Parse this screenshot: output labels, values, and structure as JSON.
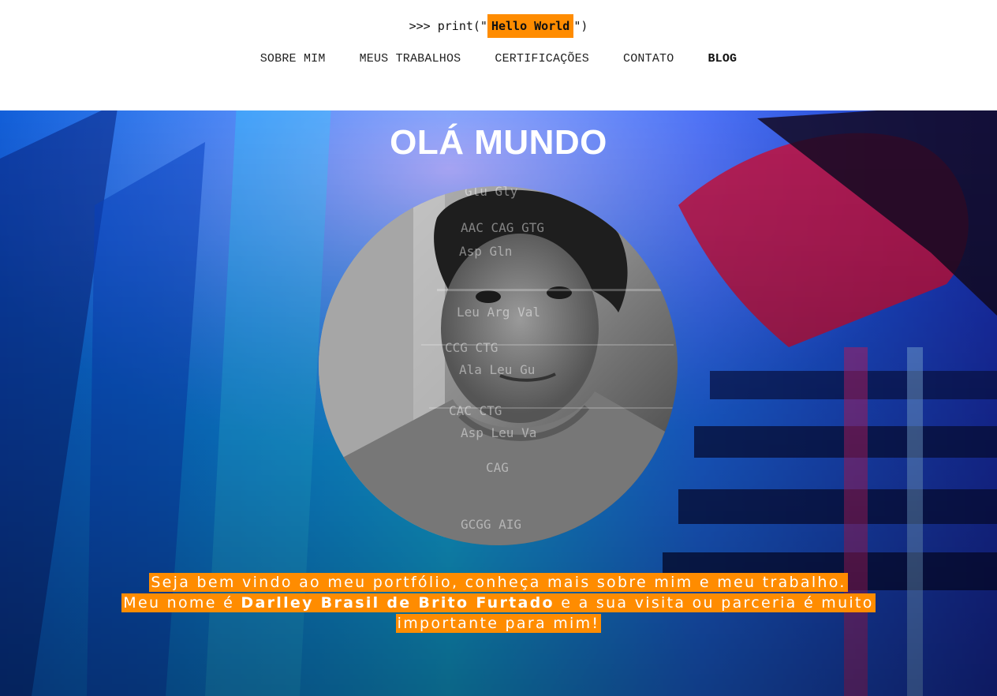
{
  "header": {
    "logo_prefix": ">>> print(\"",
    "logo_highlight": "Hello World",
    "logo_suffix": "\")"
  },
  "nav": {
    "items": [
      {
        "label": "SOBRE MIM"
      },
      {
        "label": "MEUS TRABALHOS"
      },
      {
        "label": "CERTIFICAÇÕES"
      },
      {
        "label": "CONTATO"
      },
      {
        "label": "BLOG"
      }
    ]
  },
  "hero": {
    "title": "OLÁ MUNDO",
    "intro_line1": "Seja bem vindo ao meu portfólio, conheça mais sobre mim e meu trabalho.",
    "intro_line2_prefix": "Meu nome é ",
    "intro_name": "Darlley Brasil de Brito Furtado",
    "intro_line2_suffix": " e a sua visita ou parceria é muito",
    "intro_line3": "importante para mim!",
    "photo_overlay_text": [
      "Glu Gly",
      "AAC CAG GTG",
      "Asp Gln",
      "Leu Arg Val",
      "CCG CTG",
      "Ala Leu Gu",
      "CAC CTG",
      "Asp Leu Va",
      "CAG",
      "GCGG AIG"
    ]
  },
  "colors": {
    "accent": "#ff8c00",
    "hero_blue": "#0a7de8",
    "text_white": "#ffffff"
  }
}
